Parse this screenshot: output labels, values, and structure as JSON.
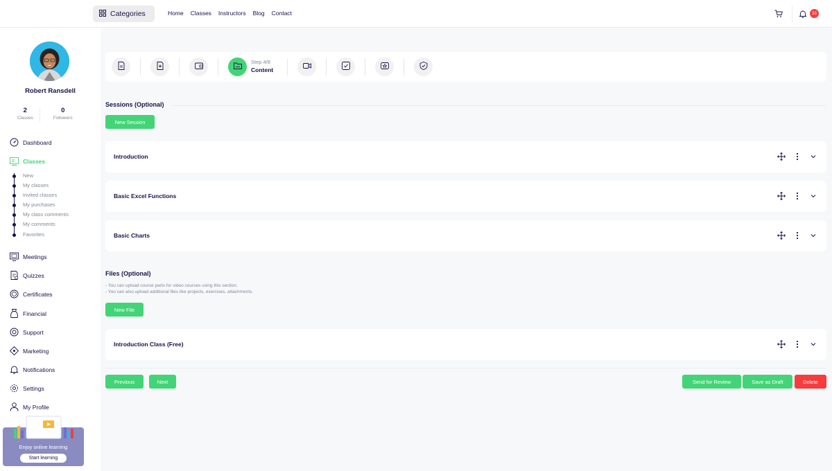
{
  "topbar": {
    "categories_label": "Categories",
    "nav": [
      "Home",
      "Classes",
      "Instructors",
      "Blog",
      "Contact"
    ],
    "notification_count": "33"
  },
  "profile": {
    "name": "Robert Ransdell",
    "classes_count": "2",
    "classes_label": "Classes",
    "followers_count": "0",
    "followers_label": "Followers"
  },
  "sidebar": {
    "dashboard": "Dashboard",
    "classes": "Classes",
    "class_sub": [
      "New",
      "My classes",
      "Invited classes",
      "My purchases",
      "My class comments",
      "My comments",
      "Favorites"
    ],
    "meetings": "Meetings",
    "quizzes": "Quizzes",
    "certificates": "Certificates",
    "financial": "Financial",
    "support": "Support",
    "marketing": "Marketing",
    "notifications": "Notifications",
    "settings": "Settings",
    "my_profile": "My Profile"
  },
  "promo": {
    "text": "Enjoy online learning",
    "button": "Start learning"
  },
  "stepper": {
    "step_label": "Step 4/8",
    "step_name": "Content",
    "current": 4,
    "total": 8
  },
  "sessions": {
    "title": "Sessions (Optional)",
    "new_button": "New Session",
    "items": [
      "Introduction",
      "Basic Excel Functions",
      "Basic Charts"
    ]
  },
  "files": {
    "title": "Files (Optional)",
    "note1": "- You can upload course parts for video courses using this section.",
    "note2": "- You can also upload additional files like projects, exercises, attachments.",
    "new_button": "New File",
    "items": [
      "Introduction Class (Free)"
    ]
  },
  "actions": {
    "previous": "Previous",
    "next": "Next",
    "send_review": "Send for Review",
    "save_draft": "Save as Draft",
    "delete": "Delete"
  },
  "colors": {
    "primary": "#43d477",
    "danger": "#f63c3c",
    "text": "#171347",
    "muted": "#818894",
    "promo": "#8a8bc0"
  }
}
